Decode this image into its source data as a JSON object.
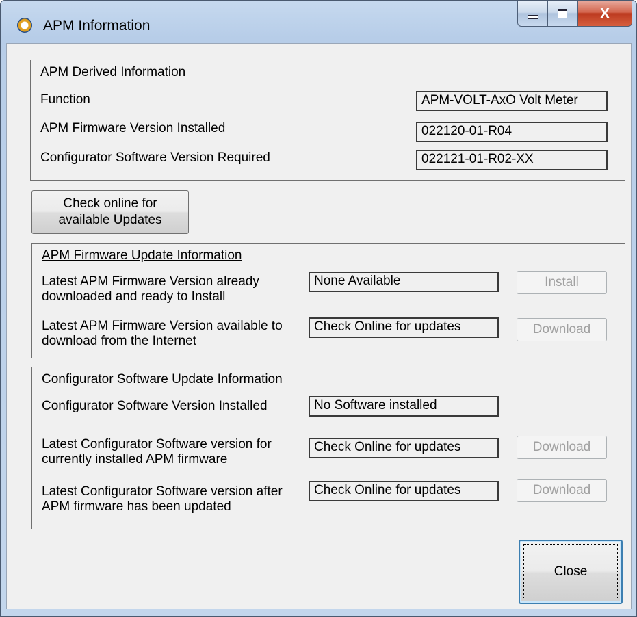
{
  "window": {
    "title": "APM Information",
    "close_glyph": "X"
  },
  "derived": {
    "title": "APM Derived Information",
    "rows": [
      {
        "label": "Function",
        "value": "APM-VOLT-AxO Volt Meter"
      },
      {
        "label": "APM Firmware Version Installed",
        "value": "022120-01-R04"
      },
      {
        "label": "Configurator Software Version Required",
        "value": "022121-01-R02-XX"
      }
    ]
  },
  "check_online_button": {
    "line1": "Check online  for",
    "line2": "available Updates"
  },
  "firmware_update": {
    "title": "APM Firmware Update Information",
    "rows": [
      {
        "label_line1": "Latest APM Firmware Version already",
        "label_line2": "downloaded and ready to Install",
        "value": "None Available",
        "button": "Install"
      },
      {
        "label_line1": "Latest APM Firmware Version available to",
        "label_line2": "download from the Internet",
        "value": "Check Online for updates",
        "button": "Download"
      }
    ]
  },
  "software_update": {
    "title": "Configurator Software Update Information",
    "installed": {
      "label": "Configurator Software Version Installed",
      "value": "No Software installed"
    },
    "rows": [
      {
        "label_line1": "Latest Configurator Software version for",
        "label_line2": "currently installed APM firmware",
        "value": "Check Online for updates",
        "button": "Download"
      },
      {
        "label_line1": "Latest Configurator Software version after",
        "label_line2": "APM firmware has been updated",
        "value": "Check Online for updates",
        "button": "Download"
      }
    ]
  },
  "close_button": "Close",
  "icons": {
    "app": "apm-app-icon",
    "minimize": "minimize-icon",
    "maximize": "maximize-icon",
    "close": "close-icon"
  }
}
